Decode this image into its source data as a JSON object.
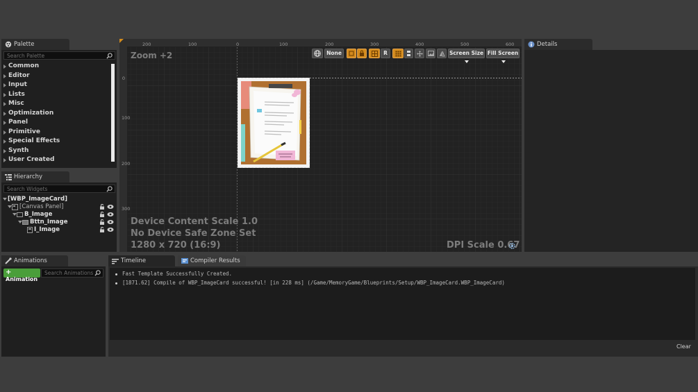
{
  "palette": {
    "tab_label": "Palette",
    "search_placeholder": "Search Palette",
    "categories": [
      "Common",
      "Editor",
      "Input",
      "Lists",
      "Misc",
      "Optimization",
      "Panel",
      "Primitive",
      "Special Effects",
      "Synth",
      "User Created"
    ]
  },
  "hierarchy": {
    "tab_label": "Hierarchy",
    "search_placeholder": "Search Widgets",
    "rows": [
      "[WBP_ImageCard]",
      "[Canvas Panel]",
      "B_Image",
      "Bttn_Image",
      "I_Image"
    ]
  },
  "viewport": {
    "zoom_label": "Zoom +2",
    "toolbar": {
      "none_label": "None",
      "r_label": "R",
      "screen_size_label": "Screen Size",
      "fill_screen_label": "Fill Screen"
    },
    "ruler_h": [
      "200",
      "100",
      "0",
      "100",
      "200",
      "300",
      "400",
      "500",
      "600"
    ],
    "ruler_v": [
      "0",
      "100",
      "200",
      "300"
    ],
    "info_lines": [
      "Device Content Scale 1.0",
      "No Device Safe Zone Set",
      "1280 x 720 (16:9)"
    ],
    "dpi_label": "DPI Scale 0.67"
  },
  "details": {
    "tab_label": "Details"
  },
  "animations": {
    "tab_label": "Animations",
    "add_button": "Animation",
    "search_placeholder": "Search Animations"
  },
  "bottom": {
    "tabs": [
      "Timeline",
      "Compiler Results"
    ],
    "log": [
      "Fast Template Successfully Created.",
      "[1871.62] Compile of WBP_ImageCard successful! [in 228 ms] (/Game/MemoryGame/Blueprints/Setup/WBP_ImageCard.WBP_ImageCard)"
    ],
    "clear_label": "Clear"
  },
  "colors": {
    "accent_orange": "#d38b1d",
    "add_green": "#4a9e3a",
    "panel_bg": "#1f1f1f"
  }
}
